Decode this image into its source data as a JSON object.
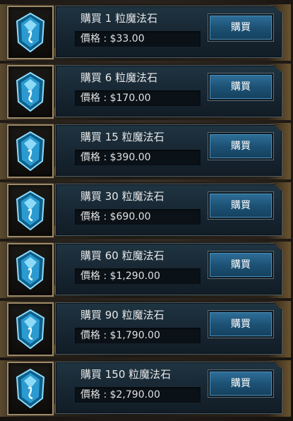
{
  "items": [
    {
      "title": "購買 1 粒魔法石",
      "price": "價格 : $33.00",
      "button": "購買",
      "icon": "magic-stone-icon"
    },
    {
      "title": "購買 6 粒魔法石",
      "price": "價格 : $170.00",
      "button": "購買",
      "icon": "magic-stone-icon"
    },
    {
      "title": "購買 15 粒魔法石",
      "price": "價格 : $390.00",
      "button": "購買",
      "icon": "magic-stone-icon"
    },
    {
      "title": "購買 30 粒魔法石",
      "price": "價格 : $690.00",
      "button": "購買",
      "icon": "magic-stone-icon"
    },
    {
      "title": "購買 60 粒魔法石",
      "price": "價格 : $1,290.00",
      "button": "購買",
      "icon": "magic-stone-icon"
    },
    {
      "title": "購買 90 粒魔法石",
      "price": "價格 : $1,790.00",
      "button": "購買",
      "icon": "magic-stone-icon"
    },
    {
      "title": "購買 150 粒魔法石",
      "price": "價格 : $2,790.00",
      "button": "購買",
      "icon": "magic-stone-icon"
    }
  ],
  "colors": {
    "panel": "#172632",
    "button": "#1d5275",
    "gold_frame": "#9e8a68",
    "gem": "#47b6e8"
  }
}
